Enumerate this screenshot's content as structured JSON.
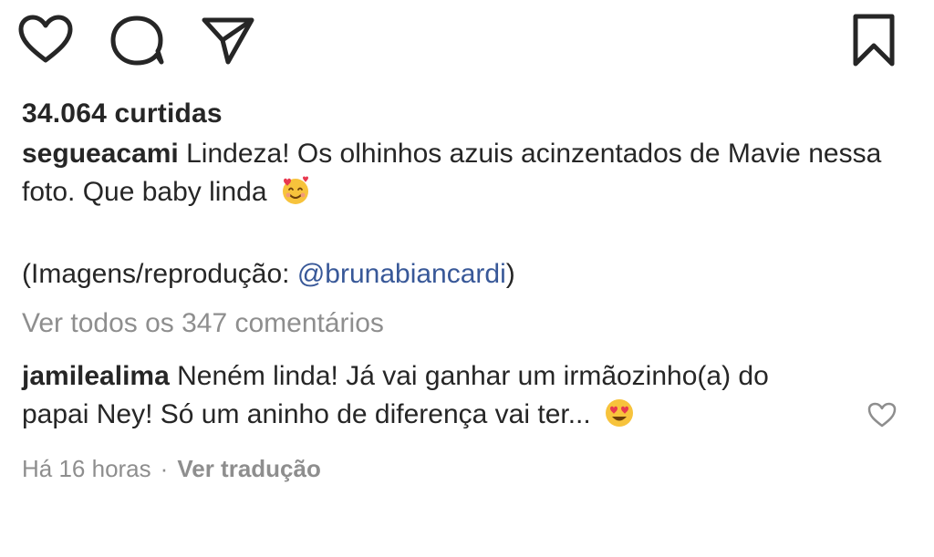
{
  "actions": {
    "like_icon": "heart-icon",
    "comment_icon": "comment-bubble-icon",
    "share_icon": "paper-plane-icon",
    "save_icon": "bookmark-icon"
  },
  "post": {
    "likes": "34.064 curtidas",
    "caption_user": "segueacami",
    "caption_text": "Lindeza! Os olhinhos  azuis acinzentados de Mavie nessa foto. Que baby linda",
    "caption_emoji": "smiling-face-with-hearts-icon",
    "credit_prefix": "(Imagens/reprodução: ",
    "credit_mention": "@brunabiancardi",
    "credit_suffix": ")",
    "view_all_comments": "Ver todos os 347 comentários"
  },
  "comment": {
    "user": "jamilealima",
    "text": "Neném linda! Já vai ganhar um irmãozinho(a) do papai Ney! Só um aninho de diferença vai ter...",
    "emoji": "heart-eyes-face-icon",
    "time": "Há 16 horas",
    "separator": "·",
    "translate": "Ver tradução",
    "like_icon": "small-heart-icon"
  },
  "colors": {
    "text": "#262626",
    "muted": "#8e8e8e",
    "mention": "#385898",
    "emoji_yellow": "#f7c33c",
    "emoji_heart": "#e8384f"
  }
}
